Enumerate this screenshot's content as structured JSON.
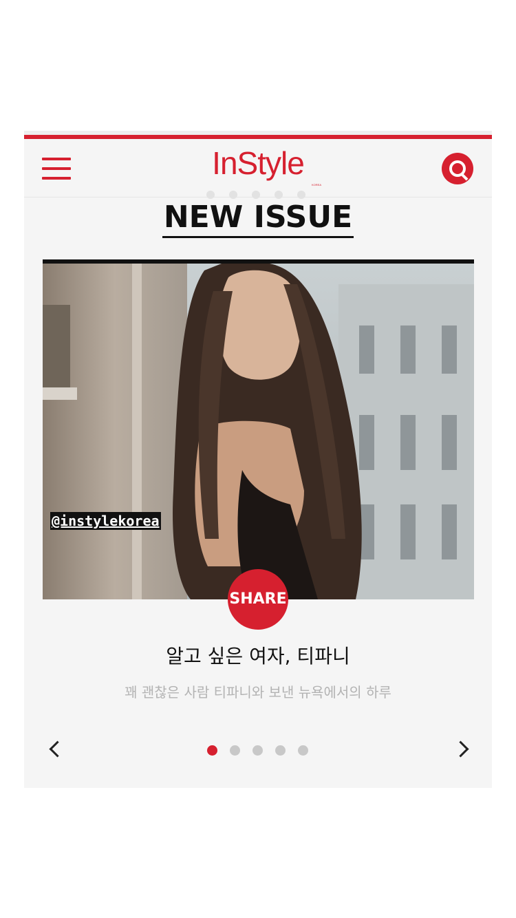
{
  "header": {
    "logo_text": "InStyle",
    "logo_sub": "KOREA",
    "menu_icon": "hamburger-menu-icon",
    "search_icon": "search-icon",
    "brand_color": "#d6202f"
  },
  "section": {
    "title": "NEW ISSUE"
  },
  "hero": {
    "handle": "@instylekorea",
    "share_label": "SHARE"
  },
  "article": {
    "title": "알고 싶은 여자, 티파니",
    "subtitle": "꽤 괜찮은 사람 티파니와 보낸 뉴욕에서의 하루"
  },
  "pager": {
    "prev_icon": "chevron-left-icon",
    "next_icon": "chevron-right-icon",
    "page_count": 5,
    "current_page": 1
  }
}
